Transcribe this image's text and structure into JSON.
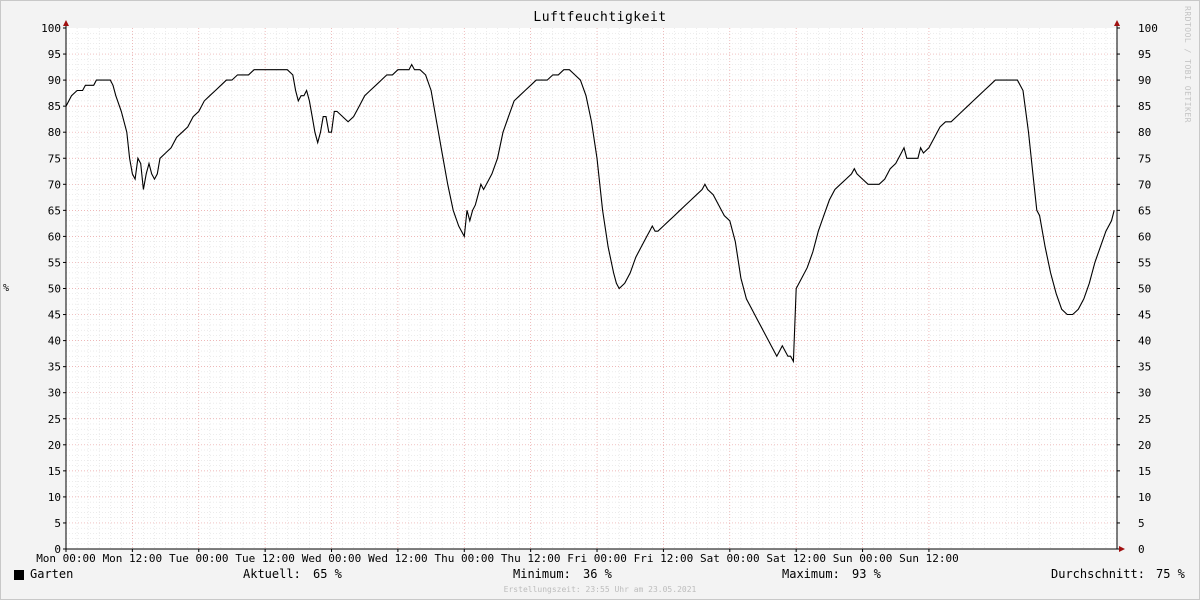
{
  "chart_data": {
    "type": "line",
    "title": "Luftfeuchtigkeit",
    "ylabel": "%",
    "ylim": [
      0,
      100
    ],
    "y_ticks": [
      0,
      5,
      10,
      15,
      20,
      25,
      30,
      35,
      40,
      45,
      50,
      55,
      60,
      65,
      70,
      75,
      80,
      85,
      90,
      95,
      100
    ],
    "x_ticks": [
      "Mon 00:00",
      "Mon 12:00",
      "Tue 00:00",
      "Tue 12:00",
      "Wed 00:00",
      "Wed 12:00",
      "Thu 00:00",
      "Thu 12:00",
      "Fri 00:00",
      "Fri 12:00",
      "Sat 00:00",
      "Sat 12:00",
      "Sun 00:00",
      "Sun 12:00"
    ],
    "x_unit": "hours since Mon 00:00",
    "xlim": [
      0,
      168
    ],
    "grid": true,
    "series": [
      {
        "name": "Garten",
        "color": "#000000",
        "points": [
          [
            0,
            85
          ],
          [
            1,
            87
          ],
          [
            2,
            88
          ],
          [
            3,
            88
          ],
          [
            3.5,
            89
          ],
          [
            4,
            89
          ],
          [
            5,
            89
          ],
          [
            5.5,
            90
          ],
          [
            6,
            90
          ],
          [
            7,
            90
          ],
          [
            8,
            90
          ],
          [
            8.5,
            89
          ],
          [
            9,
            87
          ],
          [
            10,
            84
          ],
          [
            11,
            80
          ],
          [
            11.5,
            75
          ],
          [
            12,
            72
          ],
          [
            12.5,
            71
          ],
          [
            13,
            75
          ],
          [
            13.5,
            74
          ],
          [
            14,
            69
          ],
          [
            14.5,
            72
          ],
          [
            15,
            74
          ],
          [
            15.5,
            72
          ],
          [
            16,
            71
          ],
          [
            16.5,
            72
          ],
          [
            17,
            75
          ],
          [
            18,
            76
          ],
          [
            19,
            77
          ],
          [
            20,
            79
          ],
          [
            21,
            80
          ],
          [
            22,
            81
          ],
          [
            23,
            83
          ],
          [
            24,
            84
          ],
          [
            25,
            86
          ],
          [
            26,
            87
          ],
          [
            27,
            88
          ],
          [
            28,
            89
          ],
          [
            29,
            90
          ],
          [
            30,
            90
          ],
          [
            31,
            91
          ],
          [
            32,
            91
          ],
          [
            33,
            91
          ],
          [
            34,
            92
          ],
          [
            36,
            92
          ],
          [
            38,
            92
          ],
          [
            40,
            92
          ],
          [
            41,
            91
          ],
          [
            41.5,
            88
          ],
          [
            42,
            86
          ],
          [
            42.5,
            87
          ],
          [
            43,
            87
          ],
          [
            43.5,
            88
          ],
          [
            44,
            86
          ],
          [
            44.5,
            83
          ],
          [
            45,
            80
          ],
          [
            45.5,
            78
          ],
          [
            46,
            80
          ],
          [
            46.5,
            83
          ],
          [
            47,
            83
          ],
          [
            47.5,
            80
          ],
          [
            48,
            80
          ],
          [
            48.5,
            84
          ],
          [
            49,
            84
          ],
          [
            50,
            83
          ],
          [
            51,
            82
          ],
          [
            52,
            83
          ],
          [
            53,
            85
          ],
          [
            54,
            87
          ],
          [
            55,
            88
          ],
          [
            56,
            89
          ],
          [
            57,
            90
          ],
          [
            58,
            91
          ],
          [
            59,
            91
          ],
          [
            60,
            92
          ],
          [
            61,
            92
          ],
          [
            62,
            92
          ],
          [
            62.5,
            93
          ],
          [
            63,
            92
          ],
          [
            64,
            92
          ],
          [
            65,
            91
          ],
          [
            66,
            88
          ],
          [
            67,
            82
          ],
          [
            68,
            76
          ],
          [
            69,
            70
          ],
          [
            70,
            65
          ],
          [
            71,
            62
          ],
          [
            71.5,
            61
          ],
          [
            72,
            60
          ],
          [
            72.5,
            65
          ],
          [
            73,
            63
          ],
          [
            73.5,
            65
          ],
          [
            74,
            66
          ],
          [
            74.5,
            68
          ],
          [
            75,
            70
          ],
          [
            75.5,
            69
          ],
          [
            76,
            70
          ],
          [
            77,
            72
          ],
          [
            78,
            75
          ],
          [
            79,
            80
          ],
          [
            80,
            83
          ],
          [
            81,
            86
          ],
          [
            82,
            87
          ],
          [
            83,
            88
          ],
          [
            84,
            89
          ],
          [
            85,
            90
          ],
          [
            86,
            90
          ],
          [
            87,
            90
          ],
          [
            88,
            91
          ],
          [
            89,
            91
          ],
          [
            90,
            92
          ],
          [
            91,
            92
          ],
          [
            92,
            91
          ],
          [
            93,
            90
          ],
          [
            94,
            87
          ],
          [
            95,
            82
          ],
          [
            96,
            75
          ],
          [
            97,
            65
          ],
          [
            98,
            58
          ],
          [
            99,
            53
          ],
          [
            99.5,
            51
          ],
          [
            100,
            50
          ],
          [
            101,
            51
          ],
          [
            102,
            53
          ],
          [
            103,
            56
          ],
          [
            104,
            58
          ],
          [
            105,
            60
          ],
          [
            105.5,
            61
          ],
          [
            106,
            62
          ],
          [
            106.5,
            61
          ],
          [
            107,
            61
          ],
          [
            108,
            62
          ],
          [
            109,
            63
          ],
          [
            110,
            64
          ],
          [
            111,
            65
          ],
          [
            112,
            66
          ],
          [
            113,
            67
          ],
          [
            114,
            68
          ],
          [
            115,
            69
          ],
          [
            115.5,
            70
          ],
          [
            116,
            69
          ],
          [
            117,
            68
          ],
          [
            118,
            66
          ],
          [
            119,
            64
          ],
          [
            120,
            63
          ],
          [
            121,
            59
          ],
          [
            122,
            52
          ],
          [
            123,
            48
          ],
          [
            124,
            46
          ],
          [
            125,
            44
          ],
          [
            126,
            42
          ],
          [
            127,
            40
          ],
          [
            128,
            38
          ],
          [
            128.5,
            37
          ],
          [
            129,
            38
          ],
          [
            129.5,
            39
          ],
          [
            130,
            38
          ],
          [
            130.5,
            37
          ],
          [
            131,
            37
          ],
          [
            131.5,
            36
          ],
          [
            132,
            50
          ],
          [
            133,
            52
          ],
          [
            134,
            54
          ],
          [
            135,
            57
          ],
          [
            136,
            61
          ],
          [
            137,
            64
          ],
          [
            138,
            67
          ],
          [
            139,
            69
          ],
          [
            140,
            70
          ],
          [
            141,
            71
          ],
          [
            142,
            72
          ],
          [
            142.5,
            73
          ],
          [
            143,
            72
          ],
          [
            144,
            71
          ],
          [
            145,
            70
          ],
          [
            146,
            70
          ],
          [
            147,
            70
          ],
          [
            148,
            71
          ],
          [
            149,
            73
          ],
          [
            150,
            74
          ],
          [
            151,
            76
          ],
          [
            151.5,
            77
          ],
          [
            152,
            75
          ],
          [
            153,
            75
          ],
          [
            154,
            75
          ],
          [
            154.5,
            77
          ],
          [
            155,
            76
          ],
          [
            156,
            77
          ],
          [
            157,
            79
          ],
          [
            158,
            81
          ],
          [
            159,
            82
          ],
          [
            160,
            82
          ],
          [
            161,
            83
          ],
          [
            162,
            84
          ],
          [
            163,
            85
          ],
          [
            164,
            86
          ],
          [
            165,
            87
          ],
          [
            166,
            88
          ],
          [
            167,
            89
          ],
          [
            168,
            90
          ],
          [
            169,
            90
          ],
          [
            170,
            90
          ],
          [
            171,
            90
          ],
          [
            172,
            90
          ],
          [
            173,
            88
          ],
          [
            174,
            80
          ],
          [
            175,
            70
          ],
          [
            175.5,
            65
          ],
          [
            176,
            64
          ],
          [
            177,
            58
          ],
          [
            178,
            53
          ],
          [
            179,
            49
          ],
          [
            180,
            46
          ],
          [
            181,
            45
          ],
          [
            182,
            45
          ],
          [
            183,
            46
          ],
          [
            184,
            48
          ],
          [
            185,
            51
          ],
          [
            186,
            55
          ],
          [
            187,
            58
          ],
          [
            188,
            61
          ],
          [
            189,
            63
          ],
          [
            189.5,
            65
          ]
        ]
      }
    ]
  },
  "legend": {
    "series_label": "Garten",
    "current_label": "Aktuell:",
    "current_value": "65 %",
    "min_label": "Minimum:",
    "min_value": "36 %",
    "max_label": "Maximum:",
    "max_value": "93 %",
    "avg_label": "Durchschnitt:",
    "avg_value": "75 %"
  },
  "watermark": "RRDTOOL / TOBI OETIKER",
  "footer": "Erstellungszeit: 23:55 Uhr am 23.05.2021",
  "colors": {
    "major_grid": "#e8a0a0",
    "minor_grid": "#d8d8d8",
    "axis_arrow": "#a01010",
    "plot_bg": "#ffffff"
  }
}
